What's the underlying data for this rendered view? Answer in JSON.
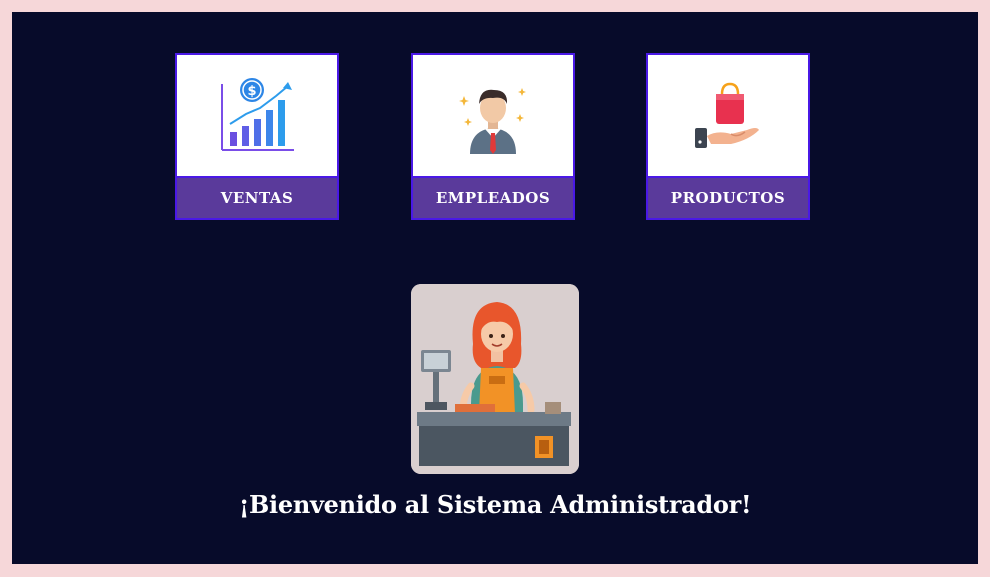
{
  "menu": {
    "items": [
      {
        "label": "VENTAS",
        "icon": "sales-chart-icon"
      },
      {
        "label": "EMPLEADOS",
        "icon": "employee-icon"
      },
      {
        "label": "PRODUCTOS",
        "icon": "product-bag-icon"
      }
    ]
  },
  "welcome": {
    "message": "¡Bienvenido al Sistema Administrador!",
    "image": "cashier-illustration"
  },
  "colors": {
    "page_background": "#f6d7d9",
    "panel_background": "#070b2a",
    "card_border": "#4a19e6",
    "card_label_background": "#5a3a9b"
  }
}
